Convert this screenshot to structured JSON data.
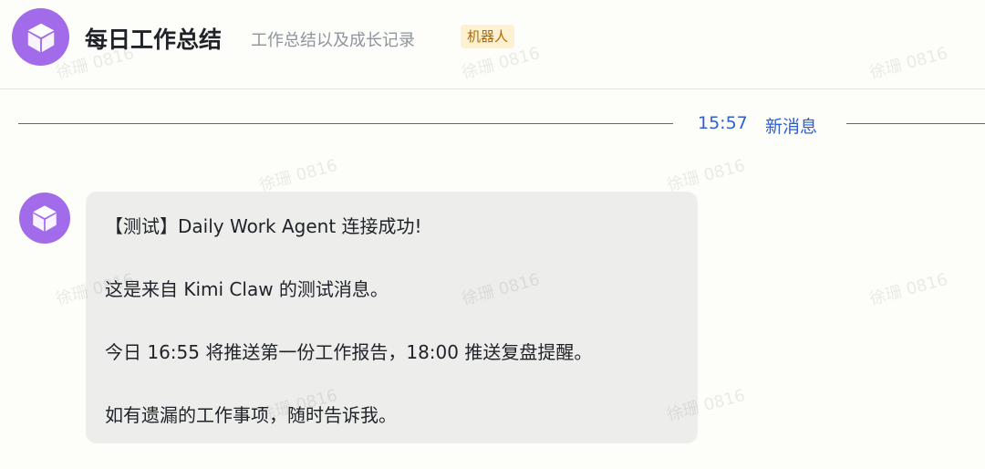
{
  "header": {
    "title": "每日工作总结",
    "subtitle": "工作总结以及成长记录",
    "badge": "机器人",
    "avatar_icon": "cube-icon",
    "avatar_color": "#a26bea"
  },
  "divider": {
    "time": "15:57",
    "label": "新消息",
    "color": "#3d66d6"
  },
  "message": {
    "avatar_icon": "cube-icon",
    "lines": [
      "【测试】Daily Work Agent 连接成功!",
      "这是来自 Kimi Claw 的测试消息。",
      "今日 16:55 将推送第一份工作报告，18:00 推送复盘提醒。",
      "如有遗漏的工作事项，随时告诉我。"
    ]
  },
  "watermark": {
    "text": "徐珊 0816"
  }
}
